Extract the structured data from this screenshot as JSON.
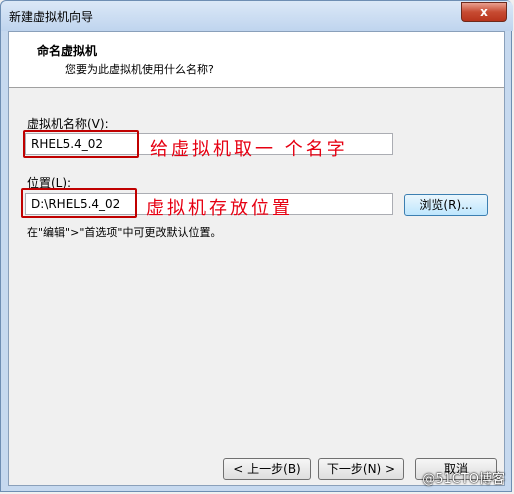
{
  "window": {
    "title": "新建虚拟机向导",
    "close_label": "x"
  },
  "header": {
    "title": "命名虚拟机",
    "subtitle": "您要为此虚拟机使用什么名称?"
  },
  "name_section": {
    "label": "虚拟机名称(V):",
    "value": "RHEL5.4_02",
    "annotation": "给虚拟机取一 个名字"
  },
  "location_section": {
    "label": "位置(L):",
    "value": "D:\\RHEL5.4_02",
    "annotation": "虚拟机存放位置",
    "browse_label": "浏览(R)..."
  },
  "hint": "在\"编辑\">\"首选项\"中可更改默认位置。",
  "footer": {
    "back_label": "< 上一步(B)",
    "next_label": "下一步(N) >",
    "cancel_label": "取消"
  },
  "watermark": "@51CTO博客",
  "colors": {
    "annotation": "#e60012",
    "annotation_box": "#c00000"
  }
}
